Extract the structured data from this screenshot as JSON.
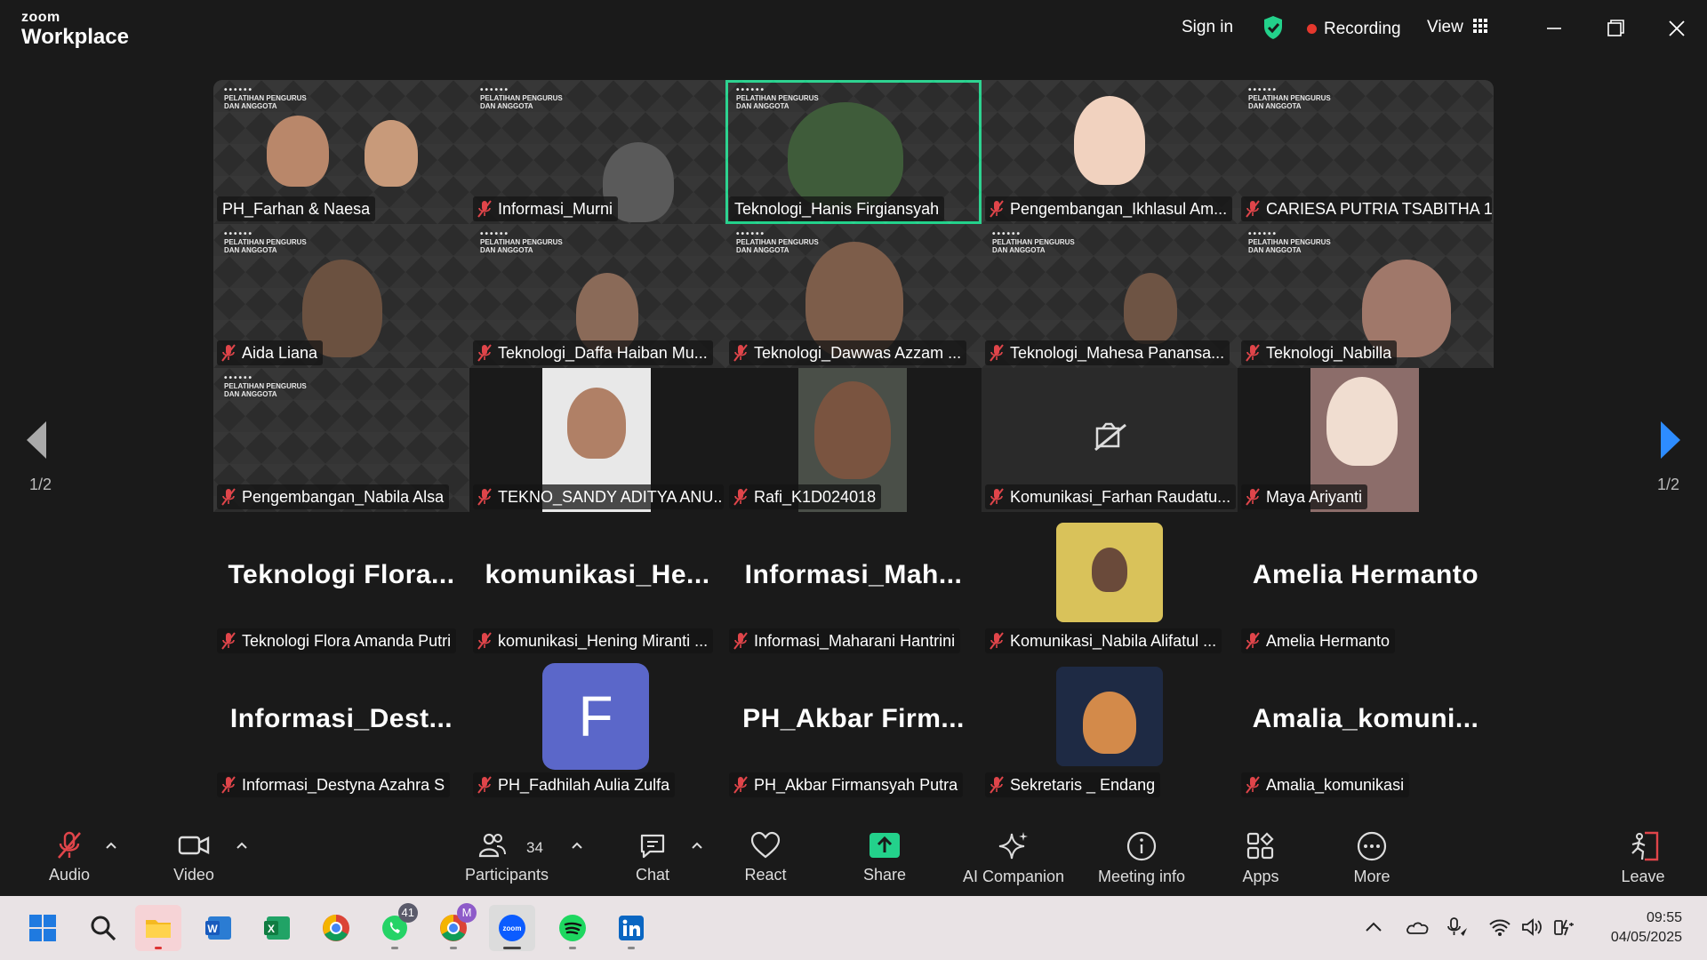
{
  "app": {
    "logo_top": "zoom",
    "logo_bottom": "Workplace",
    "sign_in": "Sign in",
    "recording": "Recording",
    "view": "View"
  },
  "banner": {
    "line1": "PELATIHAN PENGURUS",
    "line2": "DAN ANGGOTA",
    "dots": "••••••"
  },
  "page_indicator": "1/2",
  "tiles": [
    {
      "name": "PH_Farhan & Naesa",
      "muted": false
    },
    {
      "name": "Informasi_Murni",
      "muted": true
    },
    {
      "name": "Teknologi_Hanis Firgiansyah",
      "muted": false
    },
    {
      "name": "Pengembangan_Ikhlasul Am...",
      "muted": true
    },
    {
      "name": "CARIESA PUTRIA TSABITHA 1",
      "muted": true
    },
    {
      "name": "Aida Liana",
      "muted": true
    },
    {
      "name": "Teknologi_Daffa Haiban Mu...",
      "muted": true
    },
    {
      "name": "Teknologi_Dawwas Azzam ...",
      "muted": true
    },
    {
      "name": "Teknologi_Mahesa Panansa...",
      "muted": true
    },
    {
      "name": "Teknologi_Nabilla",
      "muted": true
    },
    {
      "name": "Pengembangan_Nabila Alsa",
      "muted": true
    },
    {
      "name": "TEKNO_SANDY ADITYA ANU...",
      "muted": true
    },
    {
      "name": "Rafi_K1D024018",
      "muted": true
    },
    {
      "name": "Komunikasi_Farhan Raudatu...",
      "muted": true
    },
    {
      "name": "Maya Ariyanti",
      "muted": true
    },
    {
      "name": "Teknologi Flora Amanda Putri",
      "display": "Teknologi  Flora...",
      "muted": true
    },
    {
      "name": "komunikasi_Hening Miranti ...",
      "display": "komunikasi_He...",
      "muted": true
    },
    {
      "name": "Informasi_Maharani Hantrini",
      "display": "Informasi_Mah...",
      "muted": true
    },
    {
      "name": "Komunikasi_Nabila Alifatul ...",
      "muted": true
    },
    {
      "name": "Amelia Hermanto",
      "display": "Amelia Hermanto",
      "muted": true
    },
    {
      "name": "Informasi_Destyna Azahra S",
      "display": "Informasi_Dest...",
      "muted": true
    },
    {
      "name": "PH_Fadhilah Aulia Zulfa",
      "letter": "F",
      "muted": true
    },
    {
      "name": "PH_Akbar Firmansyah Putra",
      "display": "PH_Akbar  Firm...",
      "muted": true
    },
    {
      "name": "Sekretaris _ Endang",
      "muted": true
    },
    {
      "name": "Amalia_komunikasi",
      "display": "Amalia_komuni...",
      "muted": true
    }
  ],
  "toolbar": {
    "audio": "Audio",
    "video": "Video",
    "participants": "Participants",
    "participants_count": "34",
    "chat": "Chat",
    "react": "React",
    "share": "Share",
    "ai_companion": "AI Companion",
    "meeting_info": "Meeting info",
    "apps": "Apps",
    "more": "More",
    "leave": "Leave"
  },
  "taskbar": {
    "whatsapp_badge": "41",
    "chrome_badge": "M",
    "time": "09:55",
    "date": "04/05/2025"
  },
  "colors": {
    "active_speaker": "#23d18b",
    "share_green": "#23d18b",
    "recording_dot": "#e5382d",
    "muted_red": "#e0454a",
    "avatar_purple": "#5b67c9"
  }
}
